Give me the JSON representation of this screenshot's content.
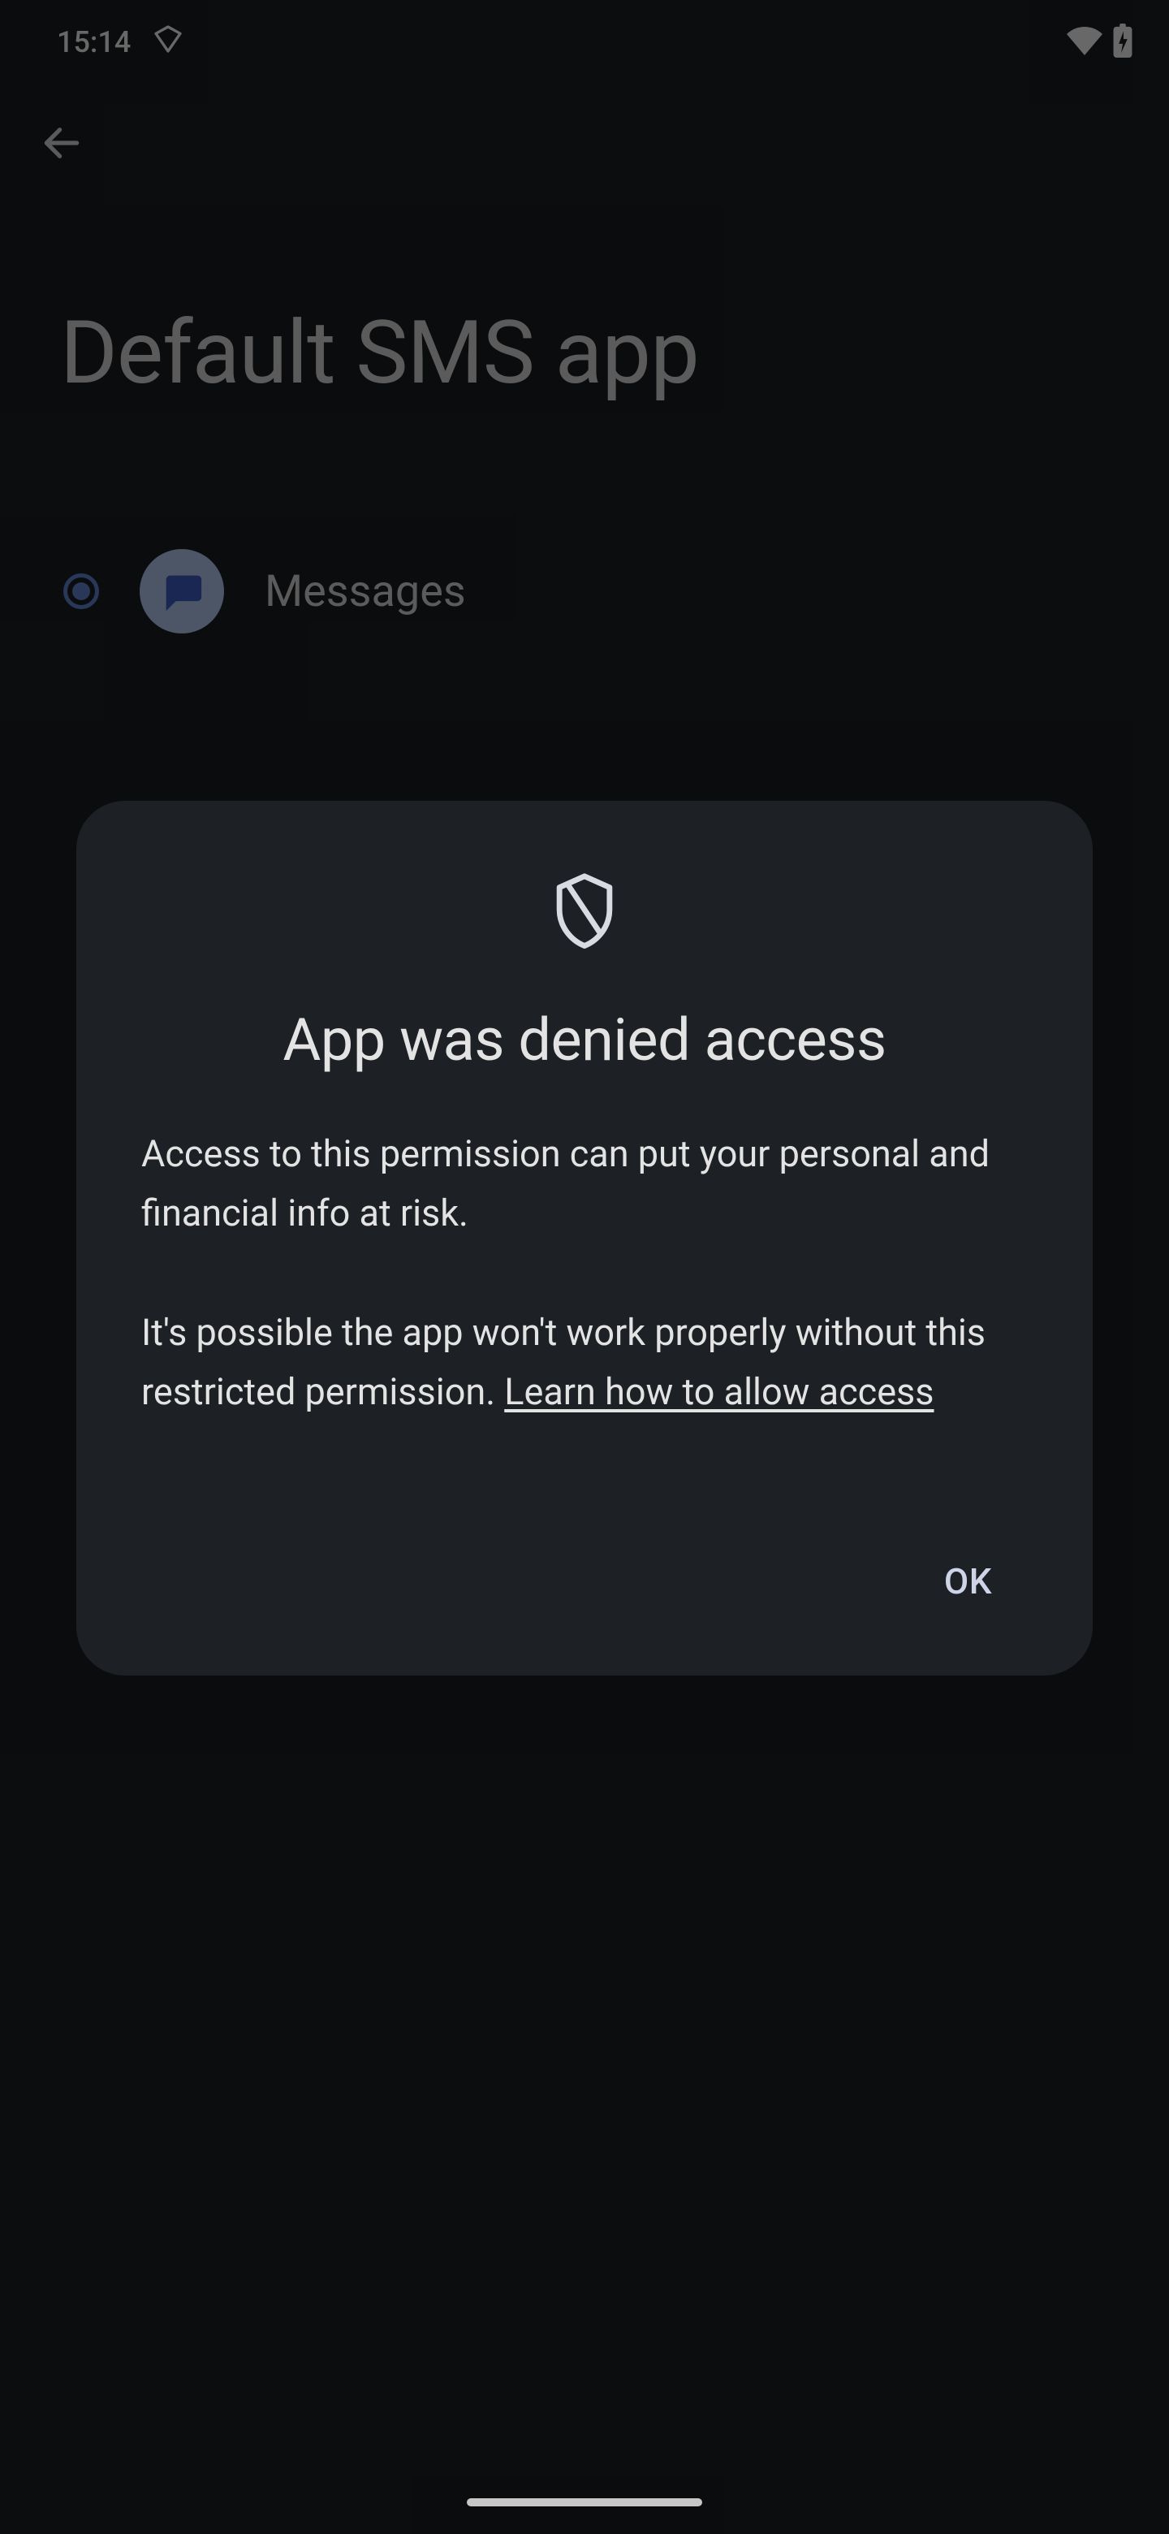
{
  "status": {
    "time": "15:14"
  },
  "background": {
    "page_title": "Default SMS app",
    "option_label": "Messages"
  },
  "dialog": {
    "title": "App was denied access",
    "body1": "Access to this permission can put your personal and financial info at risk.",
    "body2_prefix": "It's possible the app won't work properly without this restricted permission. ",
    "link": "Learn how to allow access",
    "ok": "OK"
  }
}
